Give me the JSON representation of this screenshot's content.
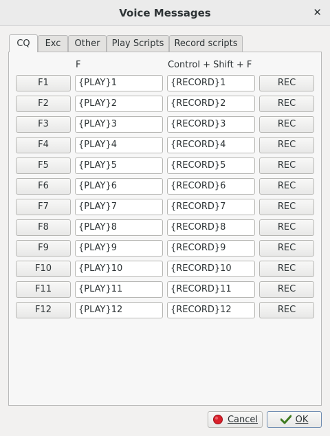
{
  "window": {
    "title": "Voice Messages",
    "close_glyph": "✕"
  },
  "tabs": [
    {
      "label": "CQ",
      "active": true
    },
    {
      "label": "Exc",
      "active": false
    },
    {
      "label": "Other",
      "active": false
    },
    {
      "label": "Play Scripts",
      "active": false
    },
    {
      "label": "Record scripts",
      "active": false
    }
  ],
  "columns": {
    "f_header": "F",
    "shift_header": "Control + Shift + F"
  },
  "rows": [
    {
      "key": "F1",
      "play": "{PLAY}1",
      "record": "{RECORD}1",
      "rec": "REC"
    },
    {
      "key": "F2",
      "play": "{PLAY}2",
      "record": "{RECORD}2",
      "rec": "REC"
    },
    {
      "key": "F3",
      "play": "{PLAY}3",
      "record": "{RECORD}3",
      "rec": "REC"
    },
    {
      "key": "F4",
      "play": "{PLAY}4",
      "record": "{RECORD}4",
      "rec": "REC"
    },
    {
      "key": "F5",
      "play": "{PLAY}5",
      "record": "{RECORD}5",
      "rec": "REC"
    },
    {
      "key": "F6",
      "play": "{PLAY}6",
      "record": "{RECORD}6",
      "rec": "REC"
    },
    {
      "key": "F7",
      "play": "{PLAY}7",
      "record": "{RECORD}7",
      "rec": "REC"
    },
    {
      "key": "F8",
      "play": "{PLAY}8",
      "record": "{RECORD}8",
      "rec": "REC"
    },
    {
      "key": "F9",
      "play": "{PLAY}9",
      "record": "{RECORD}9",
      "rec": "REC"
    },
    {
      "key": "F10",
      "play": "{PLAY}10",
      "record": "{RECORD}10",
      "rec": "REC"
    },
    {
      "key": "F11",
      "play": "{PLAY}11",
      "record": "{RECORD}11",
      "rec": "REC"
    },
    {
      "key": "F12",
      "play": "{PLAY}12",
      "record": "{RECORD}12",
      "rec": "REC"
    }
  ],
  "buttons": {
    "cancel": {
      "label": "Cancel",
      "icon": "cancel-icon",
      "color": "#d9202b"
    },
    "ok": {
      "label": "OK",
      "icon": "checkmark-icon",
      "color": "#4e8a2a"
    }
  }
}
